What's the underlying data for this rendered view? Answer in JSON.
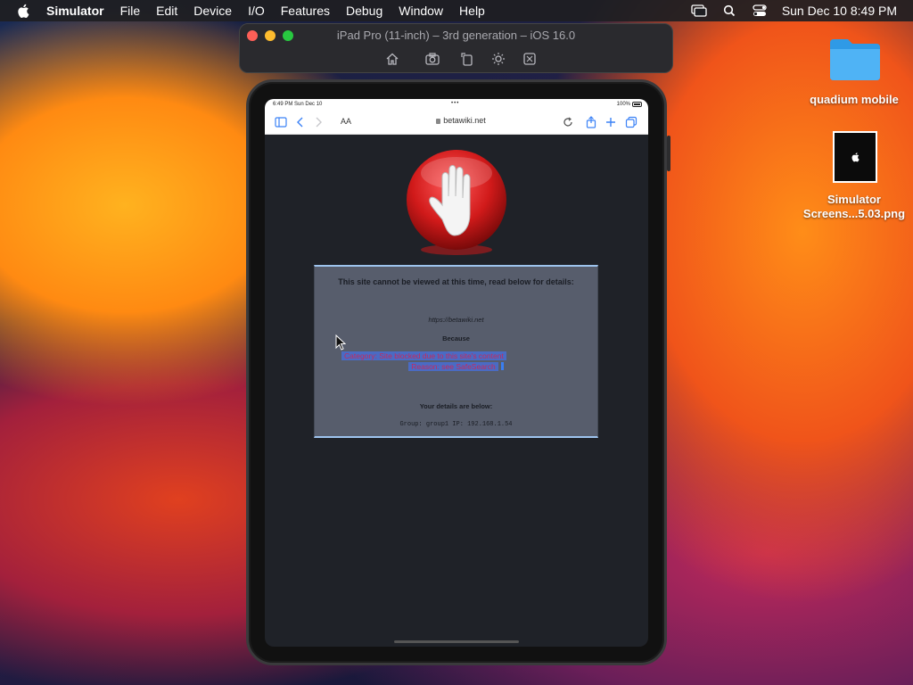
{
  "menubar": {
    "app_name": "Simulator",
    "items": [
      "File",
      "Edit",
      "Device",
      "I/O",
      "Features",
      "Debug",
      "Window",
      "Help"
    ],
    "clock": "Sun Dec 10  8:49 PM",
    "icons": [
      "apple-icon",
      "screen-mirroring-icon",
      "search-icon",
      "control-center-icon"
    ]
  },
  "simulator": {
    "title": "iPad Pro (11-inch) – 3rd generation – iOS 16.0",
    "tools": [
      "home-icon",
      "screenshot-icon",
      "rotate-icon",
      "appearance-icon",
      "shake-icon"
    ]
  },
  "ipad": {
    "status": {
      "time": "6:49 PM   Sun Dec 10",
      "dots": "•••",
      "battery": "100%"
    },
    "safari": {
      "text_size_label": "AA",
      "url": "betawiki.net",
      "icons": [
        "sidebar-icon",
        "back-icon",
        "forward-icon",
        "reload-icon",
        "share-icon",
        "new-tab-icon",
        "tabs-icon"
      ]
    },
    "page": {
      "heading": "This site cannot be viewed at this time, read below for details:",
      "blocked_url": "https://betawiki.net",
      "because_label": "Because",
      "reason_line1": "Category: Site blocked due to this site's content",
      "reason_line2": "Reason: see SafeSearch",
      "details_title": "Your details are below:",
      "details_line": "Group: group1   IP: 192.168.1.54"
    }
  },
  "desktop": {
    "folder_label": "quadium mobile",
    "screenshot_label_line1": "Simulator",
    "screenshot_label_line2": "Screens...5.03.png"
  }
}
